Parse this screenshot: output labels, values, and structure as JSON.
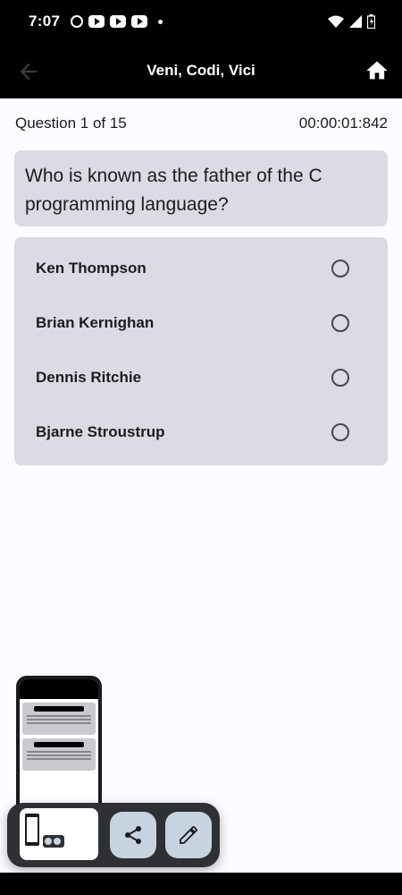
{
  "status": {
    "time": "7:07",
    "icons": [
      "circle-notification-icon",
      "youtube-icon",
      "youtube-icon",
      "youtube-icon",
      "dot-icon"
    ],
    "right_icons": [
      "wifi-icon",
      "signal-icon",
      "battery-icon"
    ]
  },
  "app_bar": {
    "title": "Veni, Codi, Vici",
    "back_icon": "arrow-back-icon",
    "home_icon": "home-icon"
  },
  "quiz": {
    "progress": "Question 1 of 15",
    "timer": "00:00:01:842",
    "question": "Who is known as the father of the C programming language?",
    "options": [
      {
        "label": "Ken Thompson",
        "selected": false
      },
      {
        "label": "Brian Kernighan",
        "selected": false
      },
      {
        "label": "Dennis Ritchie",
        "selected": false
      },
      {
        "label": "Bjarne Stroustrup",
        "selected": false
      }
    ]
  },
  "screenshot_toolbar": {
    "share_icon": "share-icon",
    "edit_icon": "pencil-icon"
  },
  "colors": {
    "app_bar_bg": "#000000",
    "card_bg": "#dcdbe3",
    "fab_bg": "#c8d3e2",
    "toolbar_bg": "#2f3033"
  }
}
